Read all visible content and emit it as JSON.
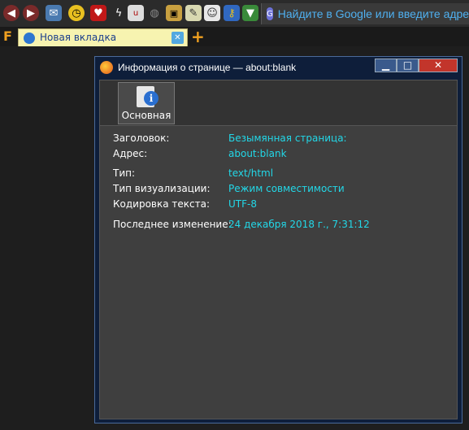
{
  "toolbar": {
    "icons": [
      "back-icon",
      "forward-icon",
      "send-icon",
      "clock-icon",
      "heart-icon",
      "lightning-icon",
      "ublock-icon",
      "globe-icon",
      "lock-icon",
      "note-icon",
      "users-icon",
      "key-icon",
      "download-icon"
    ]
  },
  "urlbar": {
    "placeholder": "Найдите в Google или введите адрес"
  },
  "tabs": [
    {
      "label": "Новая вкладка"
    }
  ],
  "dialog": {
    "title": "Информация о странице — about:blank",
    "tab_label": "Основная",
    "fields": [
      {
        "label": "Заголовок:",
        "value": "Безымянная страница:"
      },
      {
        "label": "Адрес:",
        "value": "about:blank"
      },
      {
        "label": "Тип:",
        "value": "text/html"
      },
      {
        "label": "Тип визуализации:",
        "value": "Режим совместимости"
      },
      {
        "label": "Кодировка текста:",
        "value": "UTF-8"
      },
      {
        "label": "Последнее изменение:",
        "value": "24 декабря 2018 г., 7:31:12"
      }
    ]
  },
  "colors": {
    "value_text": "#22d8e8",
    "tab_bg": "#f7f3b0",
    "accent_orange": "#f0a020"
  }
}
